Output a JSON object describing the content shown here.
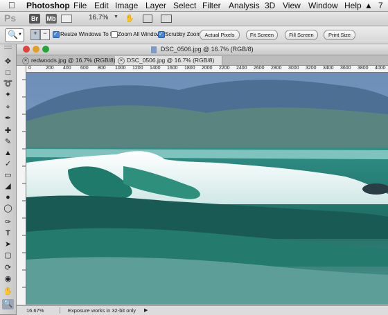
{
  "menubar": {
    "app_name": "Photoshop",
    "items": [
      "File",
      "Edit",
      "Image",
      "Layer",
      "Select",
      "Filter",
      "Analysis",
      "3D",
      "View",
      "Window",
      "Help"
    ],
    "right_text": "7"
  },
  "appbar": {
    "logo": "Ps",
    "bridge": "Br",
    "minibridge": "Mb",
    "zoom": "16.7%"
  },
  "options": {
    "resize_windows": "Resize Windows To Fit",
    "zoom_all": "Zoom All Windows",
    "scrubby": "Scrubby Zoom",
    "actual_pixels": "Actual Pixels",
    "fit_screen": "Fit Screen",
    "fill_screen": "Fill Screen",
    "print_size": "Print Size"
  },
  "document": {
    "window_title": "DSC_0506.jpg @ 16.7% (RGB/8)",
    "tabs": [
      {
        "label": "redwoods.jpg @ 16.7% (RGB/8)"
      },
      {
        "label": "DSC_0506.jpg @ 16.7% (RGB/8)"
      }
    ],
    "ruler_labels": [
      "0",
      "200",
      "400",
      "600",
      "800",
      "1000",
      "1200",
      "1400",
      "1600",
      "1800",
      "2000",
      "2200",
      "2400",
      "2600",
      "2800",
      "3000",
      "3200",
      "3400",
      "3600",
      "3800",
      "4000"
    ],
    "status_zoom": "16.67%",
    "status_text": "Exposure works in 32-bit only"
  }
}
